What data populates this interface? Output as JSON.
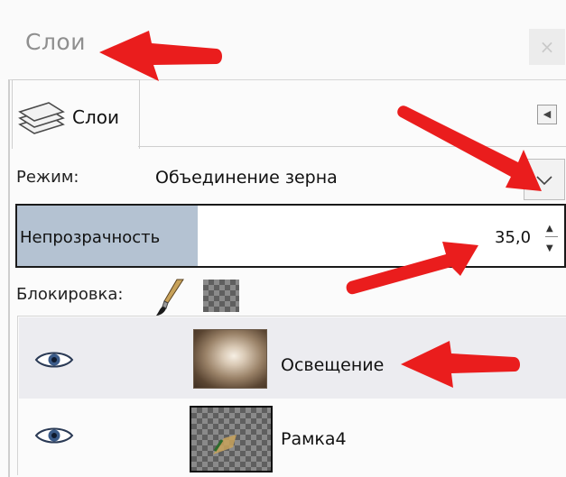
{
  "window": {
    "title": "Слои",
    "close_glyph": "×"
  },
  "tab": {
    "label": "Слои",
    "icon": "layers-icon",
    "menu_glyph": "◀"
  },
  "mode": {
    "label": "Режим:",
    "value": "Объединение зерна",
    "dropdown_glyph": "⌄"
  },
  "opacity": {
    "label": "Непрозрачность",
    "value": "35,0",
    "spin_up": "▲",
    "spin_down": "▼"
  },
  "lock": {
    "label": "Блокировка:",
    "icons": [
      "brush-lock-icon",
      "alpha-lock-icon"
    ]
  },
  "layers": [
    {
      "name": "Освещение",
      "visible": true,
      "selected": true
    },
    {
      "name": "Рамка4",
      "visible": true,
      "selected": false
    }
  ],
  "colors": {
    "accent_arrow": "#ea1d1d",
    "opacity_fill": "#b4c2d2",
    "selected_row": "#ececf0"
  }
}
